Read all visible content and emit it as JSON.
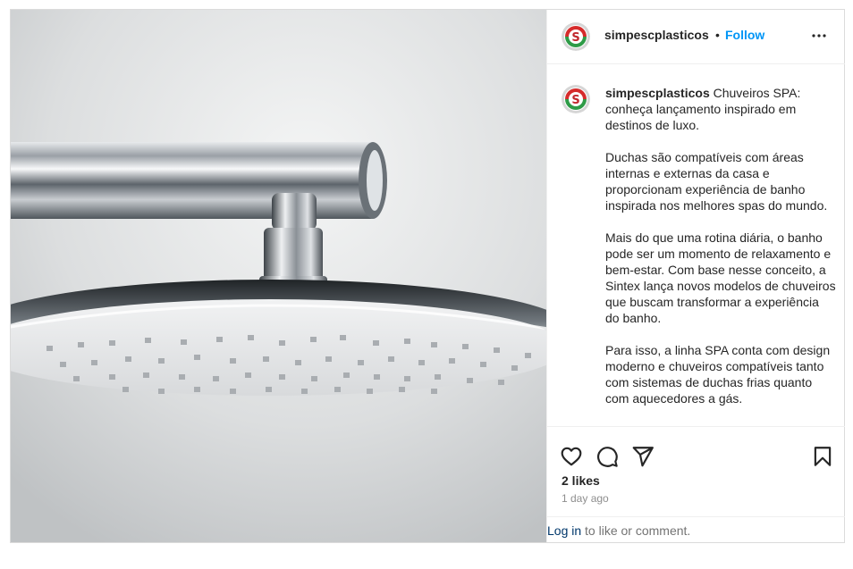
{
  "post": {
    "username": "simpescplasticos",
    "separator": "•",
    "follow_label": "Follow",
    "more_icon": "more-horizontal-icon",
    "caption_first": "Chuveiros SPA: conheça lançamento inspirado em destinos de luxo.",
    "caption_rest": "\n\nDuchas são compatíveis com áreas internas e externas da casa e proporcionam experiência de banho inspirada nos melhores spas do mundo.\n\nMais do que uma rotina diária, o banho pode ser um momento de relaxamento e bem-estar. Com base nesse conceito, a Sintex lança novos modelos de chuveiros que buscam transformar a experiência do banho.\n\nPara isso, a linha SPA conta com design moderno e chuveiros compatíveis tanto com sistemas de duchas frias quanto com aquecedores a gás.",
    "likes": "2 likes",
    "time_ago": "1 day ago",
    "login_link": "Log in",
    "login_rest": " to like or comment."
  },
  "icons": {
    "like": "heart-icon",
    "comment": "comment-icon",
    "share": "send-icon",
    "save": "bookmark-icon"
  },
  "colors": {
    "link_blue": "#0095f6",
    "dark_link": "#00376b",
    "muted": "#8e8e8e",
    "border": "#dbdbdb"
  }
}
